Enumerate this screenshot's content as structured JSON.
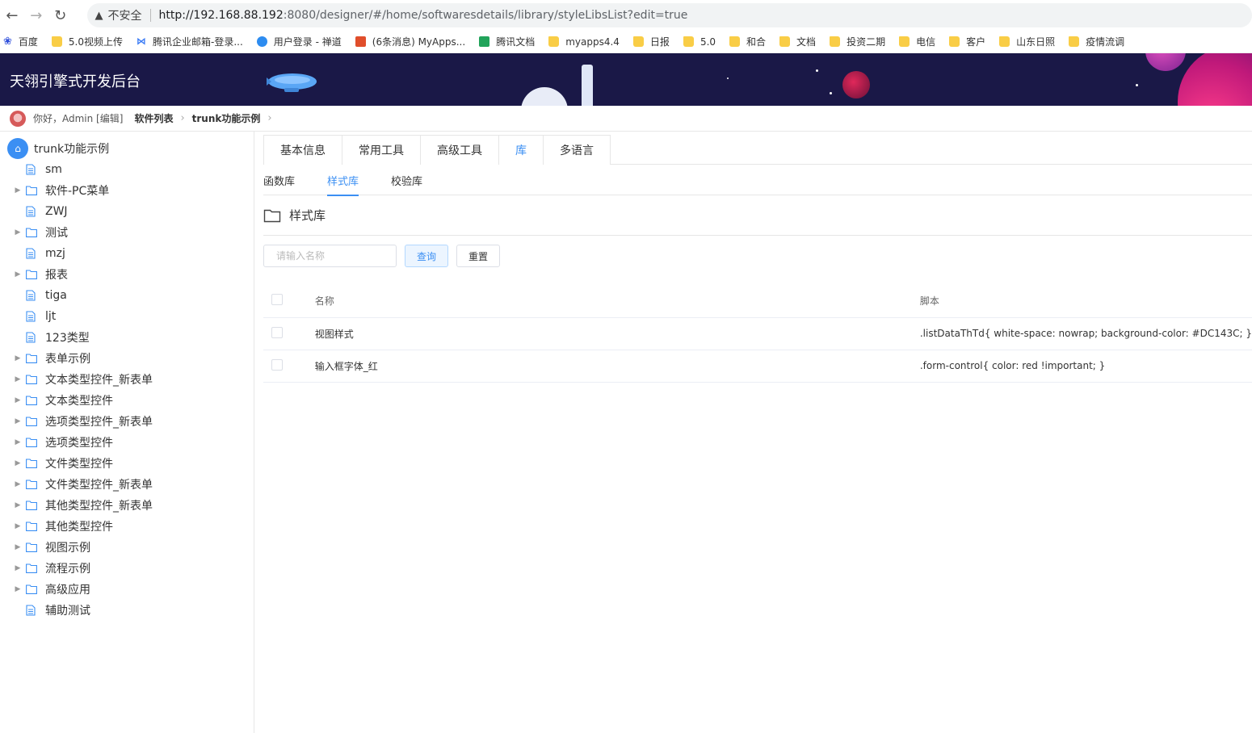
{
  "browser": {
    "security_label": "不安全",
    "url_host": "http://192.168.88.192",
    "url_rest": ":8080/designer/#/home/softwaresdetails/library/styleLibsList?edit=true",
    "bookmarks": [
      {
        "label": "百度",
        "icon": "baidu"
      },
      {
        "label": "5.0视频上传",
        "icon": "folder"
      },
      {
        "label": "腾讯企业邮箱-登录...",
        "icon": "tencent"
      },
      {
        "label": "用户登录 - 禅道",
        "icon": "chan"
      },
      {
        "label": "(6条消息) MyApps...",
        "icon": "csdn"
      },
      {
        "label": "腾讯文档",
        "icon": "txdoc"
      },
      {
        "label": "myapps4.4",
        "icon": "folder"
      },
      {
        "label": "日报",
        "icon": "folder"
      },
      {
        "label": "5.0",
        "icon": "folder"
      },
      {
        "label": "和合",
        "icon": "folder"
      },
      {
        "label": "文档",
        "icon": "folder"
      },
      {
        "label": "投资二期",
        "icon": "folder"
      },
      {
        "label": "电信",
        "icon": "folder"
      },
      {
        "label": "客户",
        "icon": "folder"
      },
      {
        "label": "山东日照",
        "icon": "folder"
      },
      {
        "label": "疫情流调",
        "icon": "folder"
      }
    ]
  },
  "header": {
    "title": "天翎引擎式开发后台"
  },
  "breadcrumb": {
    "greeting": "你好，Admin [编辑]",
    "items": [
      "软件列表",
      "trunk功能示例"
    ]
  },
  "sidebar": {
    "root": "trunk功能示例",
    "items": [
      {
        "label": "sm",
        "type": "file"
      },
      {
        "label": "软件-PC菜单",
        "type": "folder"
      },
      {
        "label": "ZWJ",
        "type": "file"
      },
      {
        "label": "测试",
        "type": "folder"
      },
      {
        "label": "mzj",
        "type": "file"
      },
      {
        "label": "报表",
        "type": "folder"
      },
      {
        "label": "tiga",
        "type": "file"
      },
      {
        "label": "ljt",
        "type": "file"
      },
      {
        "label": "123类型",
        "type": "file"
      },
      {
        "label": "表单示例",
        "type": "folder"
      },
      {
        "label": "文本类型控件_新表单",
        "type": "folder"
      },
      {
        "label": "文本类型控件",
        "type": "folder"
      },
      {
        "label": "选项类型控件_新表单",
        "type": "folder"
      },
      {
        "label": "选项类型控件",
        "type": "folder"
      },
      {
        "label": "文件类型控件",
        "type": "folder"
      },
      {
        "label": "文件类型控件_新表单",
        "type": "folder"
      },
      {
        "label": "其他类型控件_新表单",
        "type": "folder"
      },
      {
        "label": "其他类型控件",
        "type": "folder"
      },
      {
        "label": "视图示例",
        "type": "folder"
      },
      {
        "label": "流程示例",
        "type": "folder"
      },
      {
        "label": "高级应用",
        "type": "folder"
      },
      {
        "label": "辅助测试",
        "type": "file"
      }
    ]
  },
  "main": {
    "tabs": [
      {
        "label": "基本信息",
        "active": false
      },
      {
        "label": "常用工具",
        "active": false
      },
      {
        "label": "高级工具",
        "active": false
      },
      {
        "label": "库",
        "active": true
      },
      {
        "label": "多语言",
        "active": false
      }
    ],
    "subtabs": [
      {
        "label": "函数库",
        "active": false
      },
      {
        "label": "样式库",
        "active": true
      },
      {
        "label": "校验库",
        "active": false
      }
    ],
    "panel_title": "样式库",
    "search": {
      "placeholder": "请输入名称",
      "value": ""
    },
    "query_label": "查询",
    "reset_label": "重置",
    "table": {
      "columns": [
        "名称",
        "脚本"
      ],
      "rows": [
        {
          "name": "视图样式",
          "script": ".listDataThTd{ white-space: nowrap; background-color: #DC143C; }"
        },
        {
          "name": "输入框字体_红",
          "script": ".form-control{ color: red !important; }"
        }
      ]
    }
  },
  "colors": {
    "accent": "#3b8ff3",
    "header_bg": "#1a1847"
  }
}
